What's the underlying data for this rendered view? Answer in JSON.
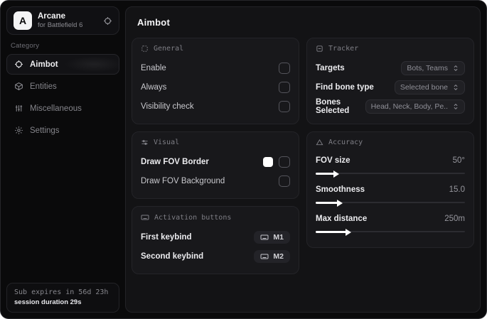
{
  "brand": {
    "initial": "A",
    "name": "Arcane",
    "subtitle": "for Battlefield 6"
  },
  "sidebar": {
    "category_label": "Category",
    "items": [
      {
        "label": "Aimbot",
        "icon": "crosshair-icon",
        "active": true
      },
      {
        "label": "Entities",
        "icon": "entities-icon",
        "active": false
      },
      {
        "label": "Miscellaneous",
        "icon": "equalizer-icon",
        "active": false
      },
      {
        "label": "Settings",
        "icon": "gear-icon",
        "active": false
      }
    ],
    "footer": {
      "sub_expiry": "Sub expires in 56d 23h",
      "session_duration": "session duration 29s"
    }
  },
  "main": {
    "title": "Aimbot",
    "general": {
      "title": "General",
      "rows": [
        {
          "label": "Enable",
          "checked": false
        },
        {
          "label": "Always",
          "checked": false
        },
        {
          "label": "Visibility check",
          "checked": false
        }
      ]
    },
    "visual": {
      "title": "Visual",
      "rows": [
        {
          "label": "Draw FOV Border",
          "swatch_color": "#ffffff",
          "checked": false
        },
        {
          "label": "Draw FOV Background",
          "checked": false
        }
      ]
    },
    "activation": {
      "title": "Activation buttons",
      "rows": [
        {
          "label": "First keybind",
          "key": "M1"
        },
        {
          "label": "Second keybind",
          "key": "M2"
        }
      ]
    },
    "tracker": {
      "title": "Tracker",
      "rows": [
        {
          "label": "Targets",
          "value": "Bots, Teams"
        },
        {
          "label": "Find bone type",
          "value": "Selected bone"
        },
        {
          "label": "Bones Selected",
          "value": "Head, Neck, Body, Pe.."
        }
      ]
    },
    "accuracy": {
      "title": "Accuracy",
      "rows": [
        {
          "label": "FOV size",
          "value": "50°",
          "fill_pct": 13
        },
        {
          "label": "Smoothness",
          "value": "15.0",
          "fill_pct": 15
        },
        {
          "label": "Max distance",
          "value": "250m",
          "fill_pct": 21
        }
      ]
    }
  },
  "colors": {
    "fov_border_swatch": "#ffffff",
    "slider_fill": "#ffffff"
  }
}
